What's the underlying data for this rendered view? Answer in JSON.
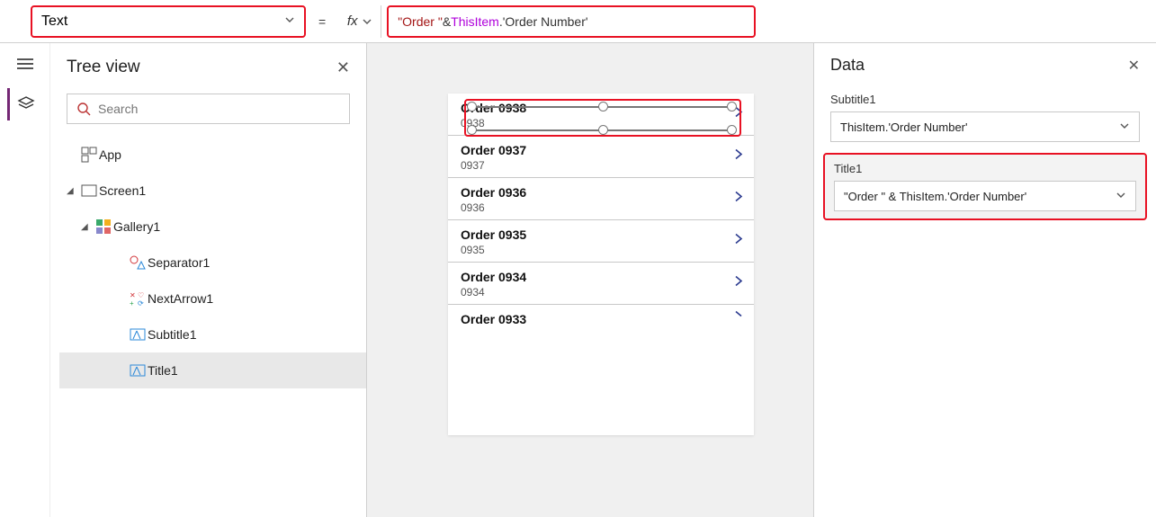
{
  "formulaBar": {
    "propertyName": "Text",
    "equals": "=",
    "fxLabel": "fx",
    "formulaRaw": "\"Order \" & ThisItem.'Order Number'",
    "tokens": {
      "str": "\"Order \"",
      "amp": " & ",
      "key": "ThisItem",
      "dot": ".",
      "prop": "'Order Number'"
    }
  },
  "treePanel": {
    "title": "Tree view",
    "searchPlaceholder": "Search",
    "nodes": {
      "app": "App",
      "screen": "Screen1",
      "gallery": "Gallery1",
      "separator": "Separator1",
      "nextArrow": "NextArrow1",
      "subtitle": "Subtitle1",
      "title": "Title1"
    }
  },
  "canvas": {
    "items": [
      {
        "title": "Order 0938",
        "sub": "0938"
      },
      {
        "title": "Order 0937",
        "sub": "0937"
      },
      {
        "title": "Order 0936",
        "sub": "0936"
      },
      {
        "title": "Order 0935",
        "sub": "0935"
      },
      {
        "title": "Order 0934",
        "sub": "0934"
      },
      {
        "title": "Order 0933",
        "sub": ""
      }
    ]
  },
  "dataPanel": {
    "title": "Data",
    "subtitle1": {
      "label": "Subtitle1",
      "value": "ThisItem.'Order Number'"
    },
    "title1": {
      "label": "Title1",
      "value": "\"Order \" & ThisItem.'Order Number'"
    }
  }
}
